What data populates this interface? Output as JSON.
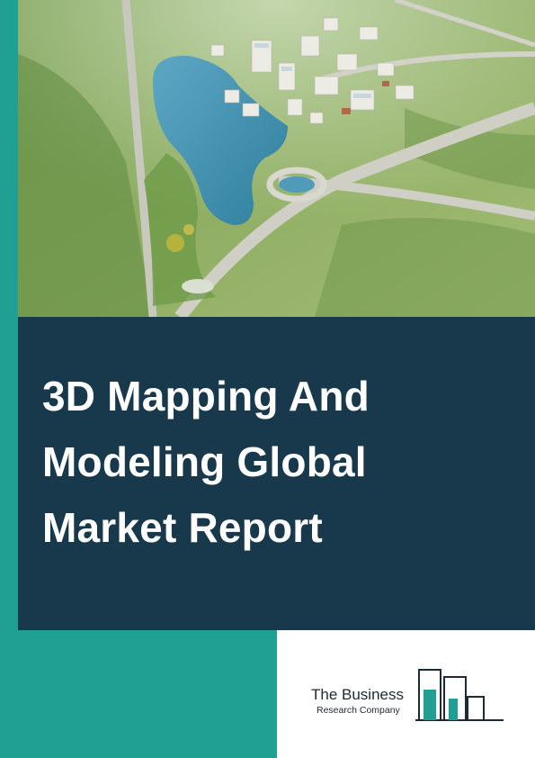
{
  "cover": {
    "image": "aerial-city-park-lake-rendering",
    "title_lines": [
      "3D Mapping And",
      "Modeling Global",
      "Market Report"
    ]
  },
  "publisher": {
    "logo_icon": "building-bars-logo-icon",
    "name": "The Business",
    "subtitle": "Research Company"
  },
  "colors": {
    "teal_accent": "#20a092",
    "navy_panel": "#17394b",
    "logo_text": "#1c2b36"
  }
}
